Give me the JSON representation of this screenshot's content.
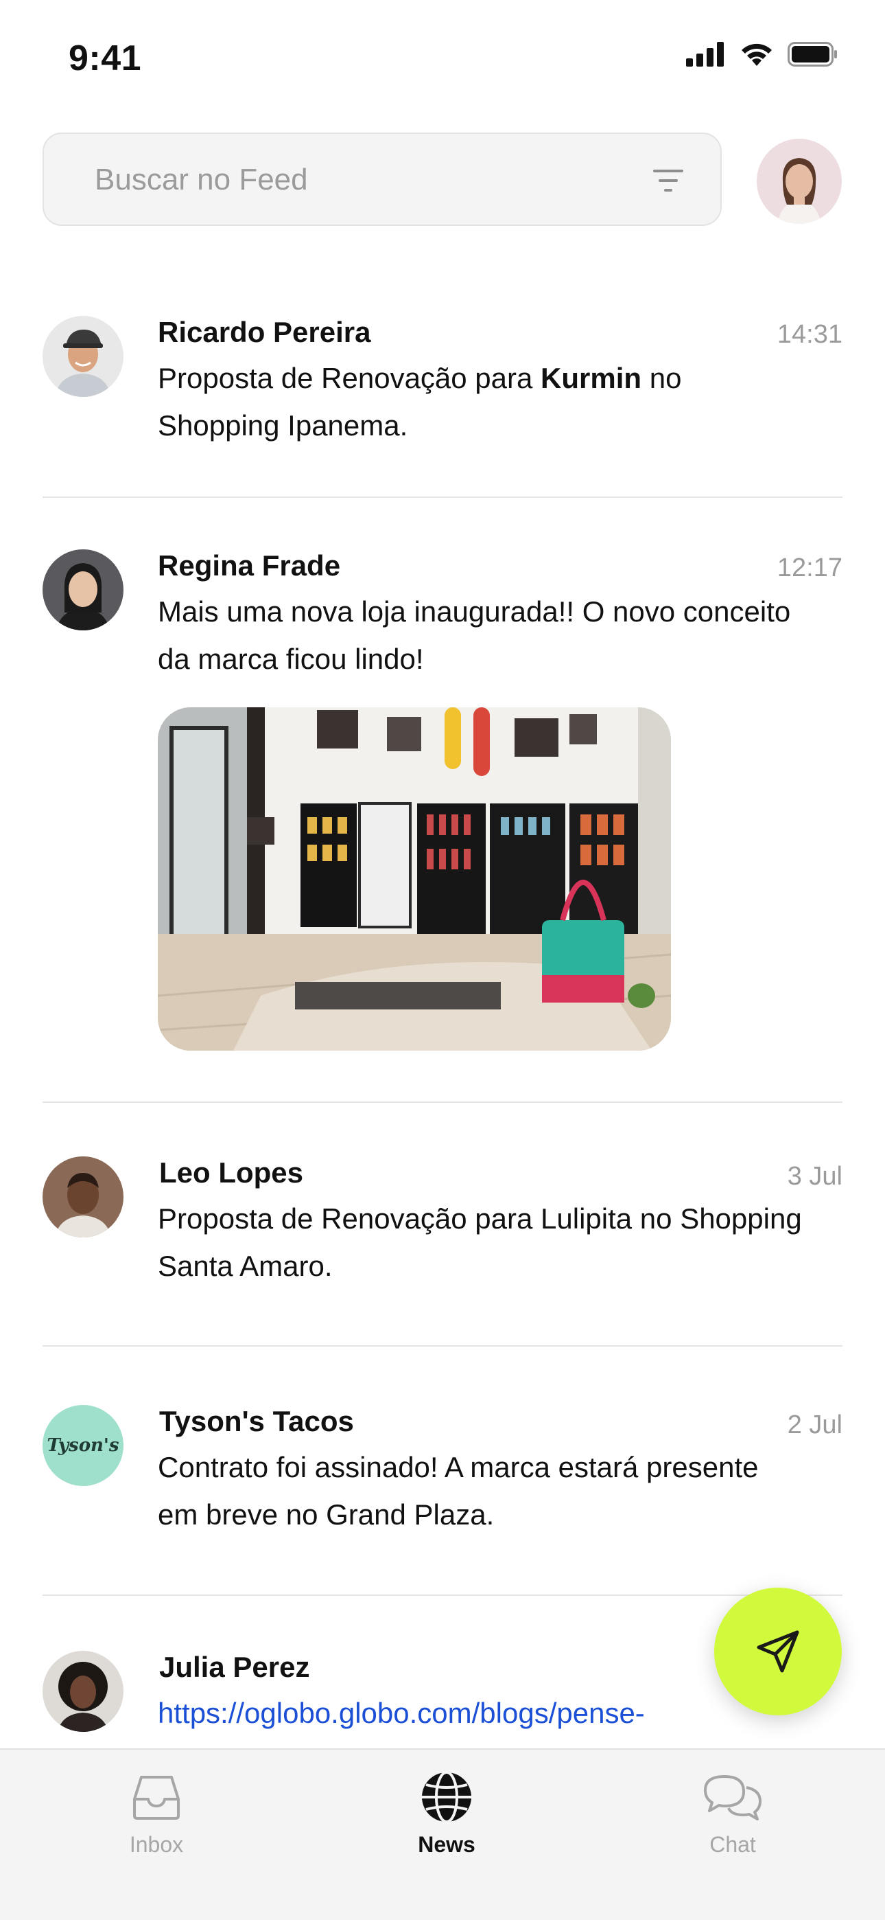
{
  "status_bar": {
    "time": "9:41"
  },
  "search": {
    "placeholder": "Buscar no Feed"
  },
  "feed": [
    {
      "author": "Ricardo Pereira",
      "time": "14:31",
      "message_parts": [
        "Proposta de Renovação para ",
        "Kurmin",
        " no Shopping Ipanema."
      ]
    },
    {
      "author": "Regina Frade",
      "time": "12:17",
      "message": "Mais uma nova loja inaugurada!! O novo conceito da marca ficou lindo!"
    },
    {
      "author": "Leo Lopes",
      "time": "3 Jul",
      "message": "Proposta de Renovação para Lulipita no Shopping Santa Amaro."
    },
    {
      "author": "Tyson's Tacos",
      "time": "2 Jul",
      "message": "Contrato foi assinado! A marca estará presente em breve no Grand Plaza.",
      "avatar_text": "Tyson's"
    },
    {
      "author": "Julia Perez",
      "time": "",
      "message": "https://oglobo.globo.com/blogs/pense-"
    }
  ],
  "tabs": [
    {
      "label": "Inbox",
      "icon": "inbox-icon",
      "active": false
    },
    {
      "label": "News",
      "icon": "globe-icon",
      "active": true
    },
    {
      "label": "Chat",
      "icon": "chat-icon",
      "active": false
    }
  ],
  "colors": {
    "fab": "#d2fa3c",
    "link": "#1a4fd6",
    "tyson_avatar_bg": "#9fe0cc"
  }
}
